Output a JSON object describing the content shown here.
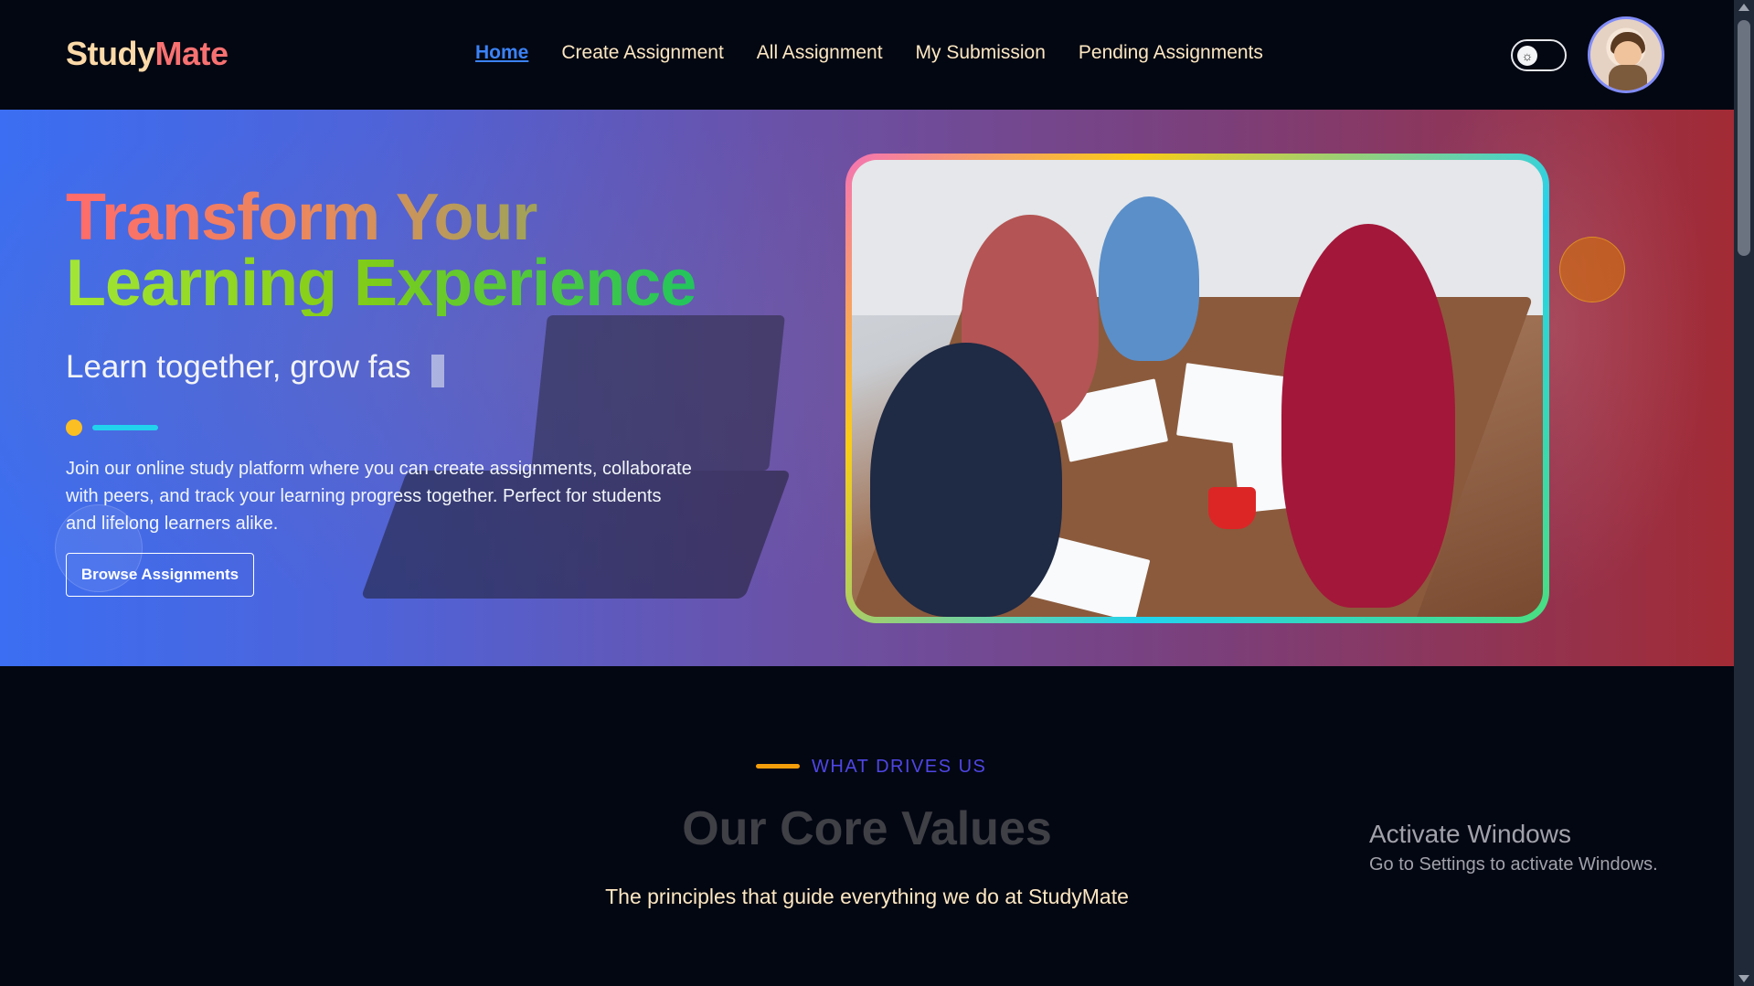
{
  "nav": {
    "logo_part1": "Study",
    "logo_part2": "Mate",
    "links": [
      "Home",
      "Create Assignment",
      "All Assignment",
      "My Submission",
      "Pending Assignments"
    ],
    "active_link": "Home"
  },
  "hero": {
    "title_line1": "Transform Your",
    "title_line2": "Learning Experience",
    "typing_text": "Learn together, grow fas",
    "description": "Join our online study platform where you can create assignments, collaborate with peers, and track your learning progress together. Perfect for students and lifelong learners alike.",
    "button_label": "Browse Assignments"
  },
  "values": {
    "tag": "WHAT DRIVES US",
    "title": "Our Core Values",
    "subtitle": "The principles that guide everything we do at StudyMate"
  },
  "watermark": {
    "line1": "Activate Windows",
    "line2": "Go to Settings to activate Windows."
  },
  "colors": {
    "background": "#030712",
    "logo_primary": "#fcd9a8",
    "logo_accent": "#f87171",
    "nav_active": "#3b82f6",
    "tag_color": "#4f46e5"
  },
  "icons": {
    "theme_toggle": "sun-icon",
    "avatar": "user-avatar"
  }
}
